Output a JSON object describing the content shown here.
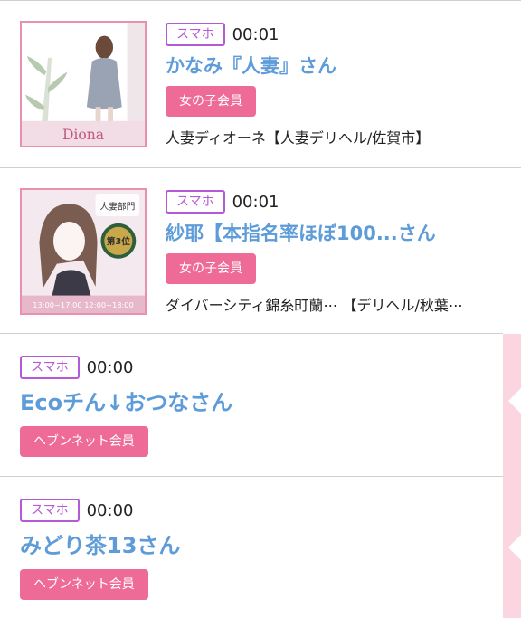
{
  "colors": {
    "tag_border": "#b45ad8",
    "name_text": "#5d9cd8",
    "member_badge": "#ee6b97",
    "thumb_border": "#e98fb0",
    "side_stripe": "#fbd6e0"
  },
  "entries": [
    {
      "device_tag": "スマホ",
      "time": "00:01",
      "name": "かなみ『人妻』さん",
      "member_badge": "女の子会員",
      "shop": "人妻ディオーネ【人妻デリヘル/佐賀市】",
      "thumb_logo": "Diona"
    },
    {
      "device_tag": "スマホ",
      "time": "00:01",
      "name": "紗耶【本指名率ほぼ100...さん",
      "member_badge": "女の子会員",
      "shop": "ダイバーシティ錦糸町蘭⋯ 【デリヘル/秋葉⋯",
      "thumb_caption": "人妻部門",
      "thumb_rank": "第3位",
      "thumb_hours": "13:00~17:00 12:00~18:00"
    },
    {
      "device_tag": "スマホ",
      "time": "00:00",
      "name": "Ecoチん↓おつなさん",
      "member_badge": "ヘブンネット会員"
    },
    {
      "device_tag": "スマホ",
      "time": "00:00",
      "name": "みどり茶13さん",
      "member_badge": "ヘブンネット会員"
    }
  ]
}
